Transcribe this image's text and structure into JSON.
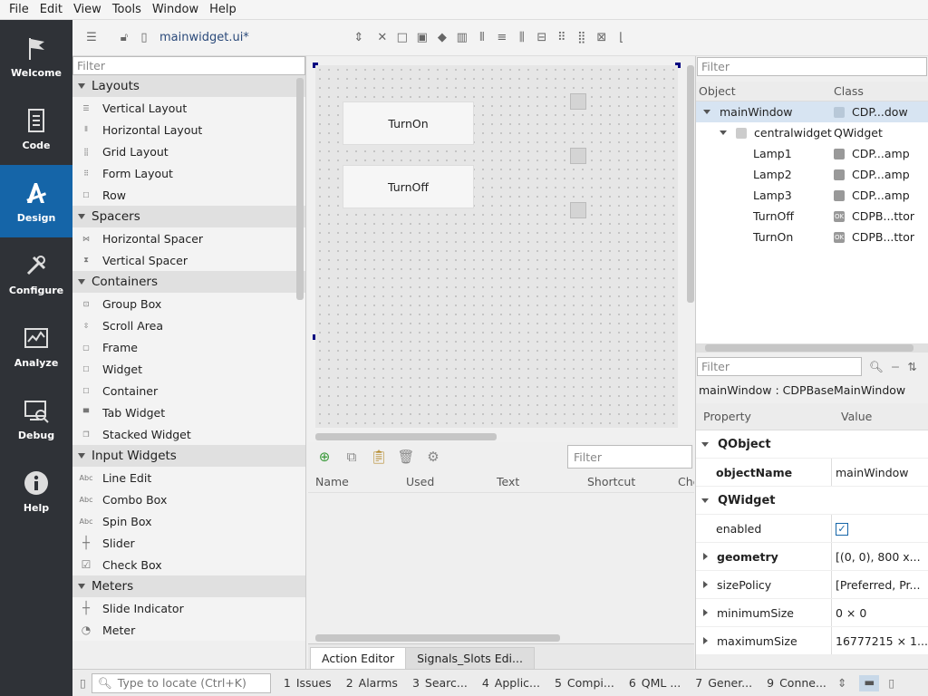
{
  "menu": {
    "file": "File",
    "edit": "Edit",
    "view": "View",
    "tools": "Tools",
    "window": "Window",
    "help": "Help"
  },
  "modes": [
    {
      "label": "Welcome",
      "icon": "flag-icon"
    },
    {
      "label": "Code",
      "icon": "document-icon"
    },
    {
      "label": "Design",
      "icon": "design-icon",
      "active": true
    },
    {
      "label": "Configure",
      "icon": "wrench-icon"
    },
    {
      "label": "Analyze",
      "icon": "chart-icon"
    },
    {
      "label": "Debug",
      "icon": "debug-icon"
    },
    {
      "label": "Help",
      "icon": "info-icon"
    }
  ],
  "toolbar": {
    "filename": "mainwidget.ui*"
  },
  "widgetbox": {
    "filter_placeholder": "Filter",
    "categories": [
      {
        "name": "Layouts",
        "items": [
          "Vertical Layout",
          "Horizontal Layout",
          "Grid Layout",
          "Form Layout",
          "Row"
        ]
      },
      {
        "name": "Spacers",
        "items": [
          "Horizontal Spacer",
          "Vertical Spacer"
        ]
      },
      {
        "name": "Containers",
        "items": [
          "Group Box",
          "Scroll Area",
          "Frame",
          "Widget",
          "Container",
          "Tab Widget",
          "Stacked Widget"
        ]
      },
      {
        "name": "Input Widgets",
        "items": [
          "Line Edit",
          "Combo Box",
          "Spin Box",
          "Slider",
          "Check Box"
        ]
      },
      {
        "name": "Meters",
        "items": [
          "Slide Indicator",
          "Meter"
        ]
      }
    ]
  },
  "form": {
    "btn_on": "TurnOn",
    "btn_off": "TurnOff"
  },
  "action_editor": {
    "filter_placeholder": "Filter",
    "columns": [
      "Name",
      "Used",
      "Text",
      "Shortcut",
      "Che"
    ],
    "tabs": [
      "Action Editor",
      "Signals_Slots Edi..."
    ]
  },
  "object_inspector": {
    "filter_placeholder": "Filter",
    "col_object": "Object",
    "col_class": "Class",
    "rows": [
      {
        "object": "mainWindow",
        "class": "CDP...dow"
      },
      {
        "object": "centralwidget",
        "class": "QWidget"
      },
      {
        "object": "Lamp1",
        "class": "CDP...amp"
      },
      {
        "object": "Lamp2",
        "class": "CDP...amp"
      },
      {
        "object": "Lamp3",
        "class": "CDP...amp"
      },
      {
        "object": "TurnOff",
        "class": "CDPB...ttor"
      },
      {
        "object": "TurnOn",
        "class": "CDPB...ttor"
      }
    ]
  },
  "property_editor": {
    "filter_placeholder": "Filter",
    "title": "mainWindow : CDPBaseMainWindow",
    "col_property": "Property",
    "col_value": "Value",
    "groups": {
      "qobject": "QObject",
      "qwidget": "QWidget"
    },
    "rows": [
      {
        "name": "objectName",
        "value": "mainWindow"
      },
      {
        "name": "enabled",
        "value": "✓"
      },
      {
        "name": "geometry",
        "value": "[(0, 0), 800 x..."
      },
      {
        "name": "sizePolicy",
        "value": "[Preferred, Pr..."
      },
      {
        "name": "minimumSize",
        "value": "0 × 0"
      },
      {
        "name": "maximumSize",
        "value": "16777215 × 1..."
      }
    ]
  },
  "statusbar": {
    "locate_placeholder": "Type to locate (Ctrl+K)",
    "panes": [
      {
        "num": "1",
        "label": "Issues"
      },
      {
        "num": "2",
        "label": "Alarms"
      },
      {
        "num": "3",
        "label": "Searc..."
      },
      {
        "num": "4",
        "label": "Applic..."
      },
      {
        "num": "5",
        "label": "Compi..."
      },
      {
        "num": "6",
        "label": "QML ..."
      },
      {
        "num": "7",
        "label": "Gener..."
      },
      {
        "num": "9",
        "label": "Conne..."
      }
    ]
  }
}
